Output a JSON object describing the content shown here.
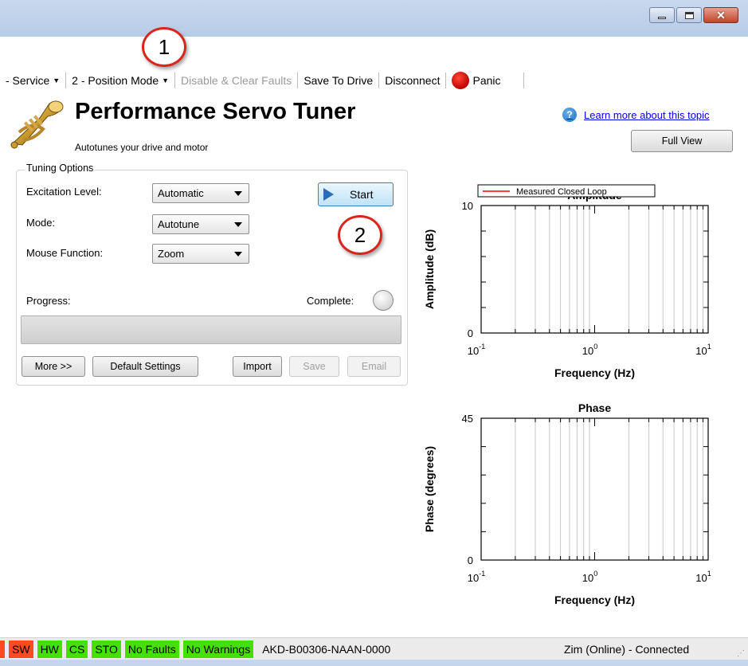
{
  "window": {
    "buttons": {
      "minimize_icon": "minimize-icon",
      "maximize_icon": "maximize-icon",
      "close_icon": "close-icon"
    }
  },
  "toolbar": {
    "items": [
      {
        "label": "- Service",
        "dropdown": true
      },
      {
        "label": "2 - Position Mode",
        "dropdown": true
      },
      {
        "label": "Disable & Clear Faults",
        "disabled": true
      },
      {
        "label": "Save To Drive"
      },
      {
        "label": "Disconnect"
      }
    ],
    "panic_label": "Panic",
    "panic_color": "#cc0000"
  },
  "callouts": {
    "one": "1",
    "two": "2",
    "color": "#d8261f"
  },
  "header": {
    "title": "Performance Servo Tuner",
    "subtitle": "Autotunes your drive and motor",
    "help_link": "Learn more about this topic",
    "full_view": "Full View"
  },
  "tuning": {
    "group_label": "Tuning Options",
    "excitation_label": "Excitation Level:",
    "excitation_value": "Automatic",
    "mode_label": "Mode:",
    "mode_value": "Autotune",
    "mouse_label": "Mouse Function:",
    "mouse_value": "Zoom",
    "start_label": "Start",
    "progress_label": "Progress:",
    "complete_label": "Complete:",
    "progress_value": 0,
    "buttons": {
      "more": "More >>",
      "default_settings": "Default Settings",
      "import": "Import",
      "save": "Save",
      "email": "Email"
    }
  },
  "chart_data": [
    {
      "type": "line",
      "title": "Amplitude",
      "xlabel": "Frequency (Hz)",
      "ylabel": "Amplitude (dB)",
      "xscale": "log",
      "xlim": [
        0.1,
        10
      ],
      "ylim": [
        0,
        10
      ],
      "xtick_bases": [
        "10",
        "10",
        "10"
      ],
      "xtick_exps": [
        "-1",
        "0",
        "1"
      ],
      "ytick_labels": [
        "10",
        "0"
      ],
      "grid": "vertical",
      "legend": "top",
      "series": [
        {
          "name": "Measured Closed Loop",
          "color": "#ff0000",
          "x": [],
          "y": []
        }
      ]
    },
    {
      "type": "line",
      "title": "Phase",
      "xlabel": "Frequency (Hz)",
      "ylabel": "Phase (degrees)",
      "xscale": "log",
      "xlim": [
        0.1,
        10
      ],
      "ylim": [
        0,
        45
      ],
      "xtick_bases": [
        "10",
        "10",
        "10"
      ],
      "xtick_exps": [
        "-1",
        "0",
        "1"
      ],
      "ytick_labels": [
        "45",
        "0"
      ],
      "grid": "vertical",
      "series": []
    }
  ],
  "statusbar": {
    "indicators": [
      {
        "label": "",
        "color": "#ff4b1f"
      },
      {
        "label": "SW",
        "color": "#ff4b1f"
      },
      {
        "label": "HW",
        "color": "#44e000"
      },
      {
        "label": "CS",
        "color": "#44e000"
      },
      {
        "label": "STO",
        "color": "#44e000"
      },
      {
        "label": "No Faults",
        "color": "#44e000"
      },
      {
        "label": "No Warnings",
        "color": "#44e000"
      }
    ],
    "drive_model": "AKD-B00306-NAAN-0000",
    "connection": "Zim (Online) - Connected"
  }
}
